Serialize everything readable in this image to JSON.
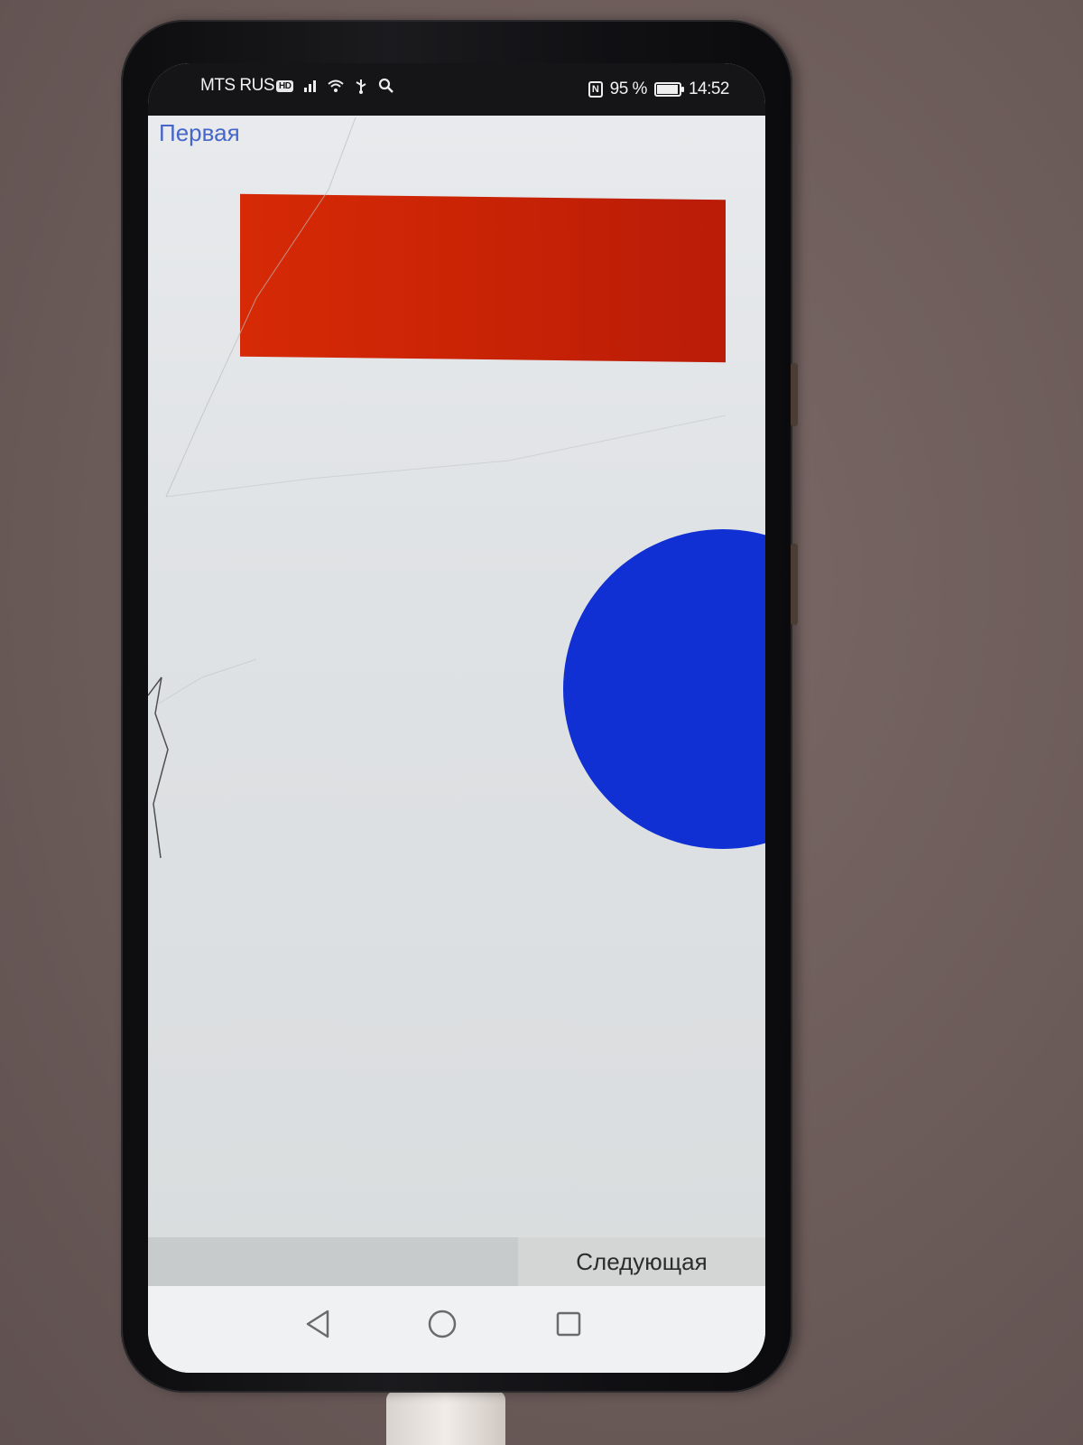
{
  "statusbar": {
    "carrier": "MTS RUS",
    "carrier_badge": "HD",
    "battery_percent": "95 %",
    "battery_level": 0.95,
    "time": "14:52"
  },
  "app": {
    "title": "Первая",
    "next_button_label": "Следующая"
  },
  "shapes": {
    "rectangle_color": "#c92305",
    "circle_color": "#1030d4"
  },
  "icons": {
    "signal": "signal-icon",
    "wifi": "wifi-icon",
    "usb": "usb-icon",
    "search": "search-icon",
    "nfc": "nfc-icon",
    "battery": "battery-icon",
    "back": "back-triangle-icon",
    "home": "home-circle-icon",
    "recents": "recents-square-icon"
  }
}
